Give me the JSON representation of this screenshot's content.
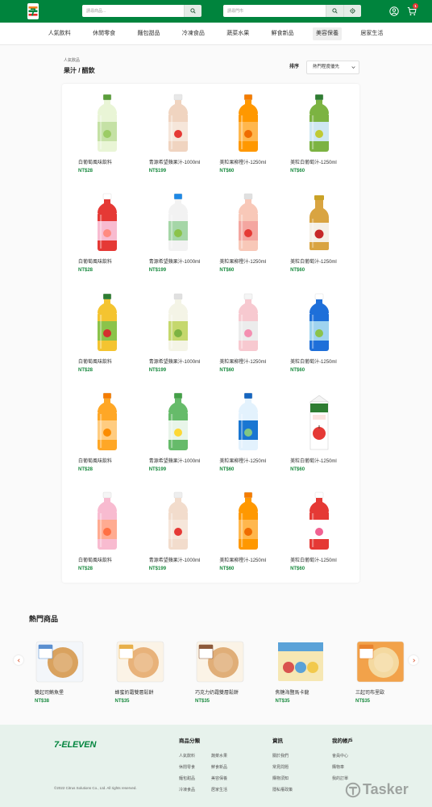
{
  "header": {
    "logo_mark": "7",
    "product_search": {
      "placeholder": "請尋商品..."
    },
    "store_search": {
      "placeholder": "請尋門市"
    },
    "cart_count": "1",
    "brand_color": "#00843d",
    "badge_color": "#e53935"
  },
  "nav": {
    "items": [
      {
        "label": "人氣飲料"
      },
      {
        "label": "休閒零食"
      },
      {
        "label": "麵包甜品"
      },
      {
        "label": "冷凍食品"
      },
      {
        "label": "蔬菜水果"
      },
      {
        "label": "鮮食新品"
      },
      {
        "label": "美容保養",
        "active": true
      },
      {
        "label": "居家生活"
      }
    ]
  },
  "listing": {
    "breadcrumb": "人氣飲品",
    "title": "果汁 / 醋飲",
    "sort_label": "排序",
    "sort_value": "熱門程度優先"
  },
  "price_color": "#1a8a3f",
  "products": [
    {
      "name": "白葡萄風味飲料",
      "price": "NT$28",
      "image": {
        "icon": "white-grape-bottle-icon",
        "cap": "#5a9e3a",
        "body": "#e9f5d6",
        "label": "#c5e1a5",
        "fruit": "#9ccc65"
      }
    },
    {
      "name": "青源希望蘋果汁-1000ml",
      "price": "NT$199",
      "image": {
        "icon": "apple-juice-bottle-icon",
        "cap": "#e8e8e8",
        "body": "#f0d4c0",
        "label": "#f6e6da",
        "fruit": "#e53935"
      }
    },
    {
      "name": "美粒果柳橙汁-1250ml",
      "price": "NT$60",
      "image": {
        "icon": "orange-juice-bottle-icon",
        "cap": "#f57c00",
        "body": "#ff9800",
        "label": "#ffb74d",
        "fruit": "#ef6c00"
      }
    },
    {
      "name": "美粒白葡萄汁-1250ml",
      "price": "NT$60",
      "image": {
        "icon": "white-grape-juice-bottle-icon",
        "cap": "#2e7d32",
        "body": "#7cb342",
        "label": "#cfe7f2",
        "fruit": "#c0ca33"
      }
    },
    {
      "name": "白葡萄風味飲料",
      "price": "NT$28",
      "image": {
        "icon": "peach-drink-bottle-icon",
        "cap": "#ffffff",
        "body": "#e53935",
        "label": "#f8bbd0",
        "fruit": "#ff8a80"
      }
    },
    {
      "name": "青源希望蘋果汁-1000ml",
      "price": "NT$199",
      "image": {
        "icon": "apple-juice-bottle-icon",
        "cap": "#1e88e5",
        "body": "#f2f2f2",
        "label": "#a5d6a7",
        "fruit": "#8bc34a"
      }
    },
    {
      "name": "美粒果柳橙汁-1250ml",
      "price": "NT$60",
      "image": {
        "icon": "apple-drink-bottle-icon",
        "cap": "#e0e0e0",
        "body": "#f8c8b8",
        "label": "#f4a6a0",
        "fruit": "#e53935"
      }
    },
    {
      "name": "美粒白葡萄汁-1250ml",
      "price": "NT$60",
      "image": {
        "icon": "apple-juice-glass-bottle-icon",
        "cap": "#c9a227",
        "body": "#d9a441",
        "label": "#f5f0e6",
        "fruit": "#c62828"
      }
    },
    {
      "name": "白葡萄風味飲料",
      "price": "NT$28",
      "image": {
        "icon": "apple-juice-bottle-icon",
        "cap": "#2e7d32",
        "body": "#f4c430",
        "label": "#8bc34a",
        "fruit": "#d32f2f"
      }
    },
    {
      "name": "青源希望蘋果汁-1000ml",
      "price": "NT$199",
      "image": {
        "icon": "aloe-drink-bottle-icon",
        "cap": "#e0e0e0",
        "body": "#f4f4e6",
        "label": "#c5d86d",
        "fruit": "#7cb342"
      }
    },
    {
      "name": "美粒果柳橙汁-1250ml",
      "price": "NT$60",
      "image": {
        "icon": "aloe-drink-bottle-icon",
        "cap": "#f5f5f5",
        "body": "#f7c9d0",
        "label": "#ececec",
        "fruit": "#f48fb1"
      }
    },
    {
      "name": "美粒白葡萄汁-1250ml",
      "price": "NT$60",
      "image": {
        "icon": "coconut-water-bottle-icon",
        "cap": "#ffffff",
        "body": "#1e6fd9",
        "label": "#9fd3ef",
        "fruit": "#8bc34a"
      }
    },
    {
      "name": "白葡萄風味飲料",
      "price": "NT$28",
      "image": {
        "icon": "orange-juice-bottle-icon",
        "cap": "#f57c00",
        "body": "#ffa726",
        "label": "#ffcc80",
        "fruit": "#fb8c00"
      }
    },
    {
      "name": "青源希望蘋果汁-1000ml",
      "price": "NT$199",
      "image": {
        "icon": "green-tea-bottle-icon",
        "cap": "#43a047",
        "body": "#66bb6a",
        "label": "#e8f5e9",
        "fruit": "#fdd835"
      }
    },
    {
      "name": "美粒果柳橙汁-1250ml",
      "price": "NT$60",
      "image": {
        "icon": "coconut-water-bottle-icon",
        "cap": "#1565c0",
        "body": "#e3f2fd",
        "label": "#1976d2",
        "fruit": "#81c784"
      }
    },
    {
      "name": "美粒白葡萄汁-1250ml",
      "price": "NT$60",
      "image": {
        "icon": "apple-juice-carton-icon",
        "cap": "#2e7d32",
        "body": "#ffffff",
        "label": "#e53935"
      }
    },
    {
      "name": "白葡萄風味飲料",
      "price": "NT$28",
      "image": {
        "icon": "peach-juice-bottle-icon",
        "cap": "#f5f5f5",
        "body": "#f8bbd0",
        "label": "#ffab91",
        "fruit": "#ff7043"
      }
    },
    {
      "name": "青源希望蘋果汁-1000ml",
      "price": "NT$199",
      "image": {
        "icon": "apple-juice-bottle-icon",
        "cap": "#eeeeee",
        "body": "#f2dccc",
        "label": "#f6e6da",
        "fruit": "#e53935"
      }
    },
    {
      "name": "美粒果柳橙汁-1250ml",
      "price": "NT$60",
      "image": {
        "icon": "orange-juice-bottle-icon",
        "cap": "#f57c00",
        "body": "#ff9800",
        "label": "#ffb74d",
        "fruit": "#ef6c00"
      }
    },
    {
      "name": "美粒白葡萄汁-1250ml",
      "price": "NT$60",
      "image": {
        "icon": "peach-drink-bottle-icon",
        "cap": "#ffffff",
        "body": "#e53935",
        "label": "#ffffff",
        "fruit": "#f06292"
      }
    }
  ],
  "hot_products": {
    "title": "熱門商品",
    "items": [
      {
        "name": "雙起司鮪魚堡",
        "price": "NT$38",
        "image": {
          "icon": "tuna-cheese-bun-package-icon",
          "wrapper": "#f3f6fa",
          "label": "#5b8fd0",
          "food": "#d9a25f"
        }
      },
      {
        "name": "蜂蜜奶霜雙層鬆餅",
        "price": "NT$35",
        "image": {
          "icon": "honey-pancake-package-icon",
          "wrapper": "#fbf3e6",
          "label": "#e8b04a",
          "food": "#e8b27a"
        }
      },
      {
        "name": "巧克力奶霜雙層鬆餅",
        "price": "NT$35",
        "image": {
          "icon": "chocolate-pancake-package-icon",
          "wrapper": "#fbf3e6",
          "label": "#8d5a3b",
          "food": "#e0ae78"
        }
      },
      {
        "name": "焦糖海鹽馬卡龍",
        "price": "NT$35",
        "image": {
          "icon": "macaron-box-icon",
          "wrapper": "#f6e7b3",
          "label": "#5aa2d8",
          "food": "#d9534f"
        }
      },
      {
        "name": "三起司布里歐",
        "price": "NT$35",
        "image": {
          "icon": "cheese-brioche-package-icon",
          "wrapper": "#f2a24a",
          "label": "#e8832e",
          "food": "#f4d9a0"
        }
      }
    ]
  },
  "footer": {
    "logo": "7-ELEVEN",
    "copyright": "©2022 Citrus Solutions Co., Ltd. All rights reserved.",
    "background": "#e7f2ec",
    "columns": [
      {
        "title": "商品分類",
        "items": [
          "人氣飲料",
          "休閒零食",
          "麵包甜品",
          "冷凍食品",
          "蔬菜水果",
          "鮮食新品",
          "美容保養",
          "居家生活"
        ]
      },
      {
        "title": "資訊",
        "items": [
          "關於我們",
          "常見問題",
          "購物須知",
          "隱私權政策"
        ]
      },
      {
        "title": "我的帳戶",
        "items": [
          "會員中心",
          "購物車",
          "我的訂單"
        ]
      }
    ]
  },
  "watermark": "Tasker"
}
